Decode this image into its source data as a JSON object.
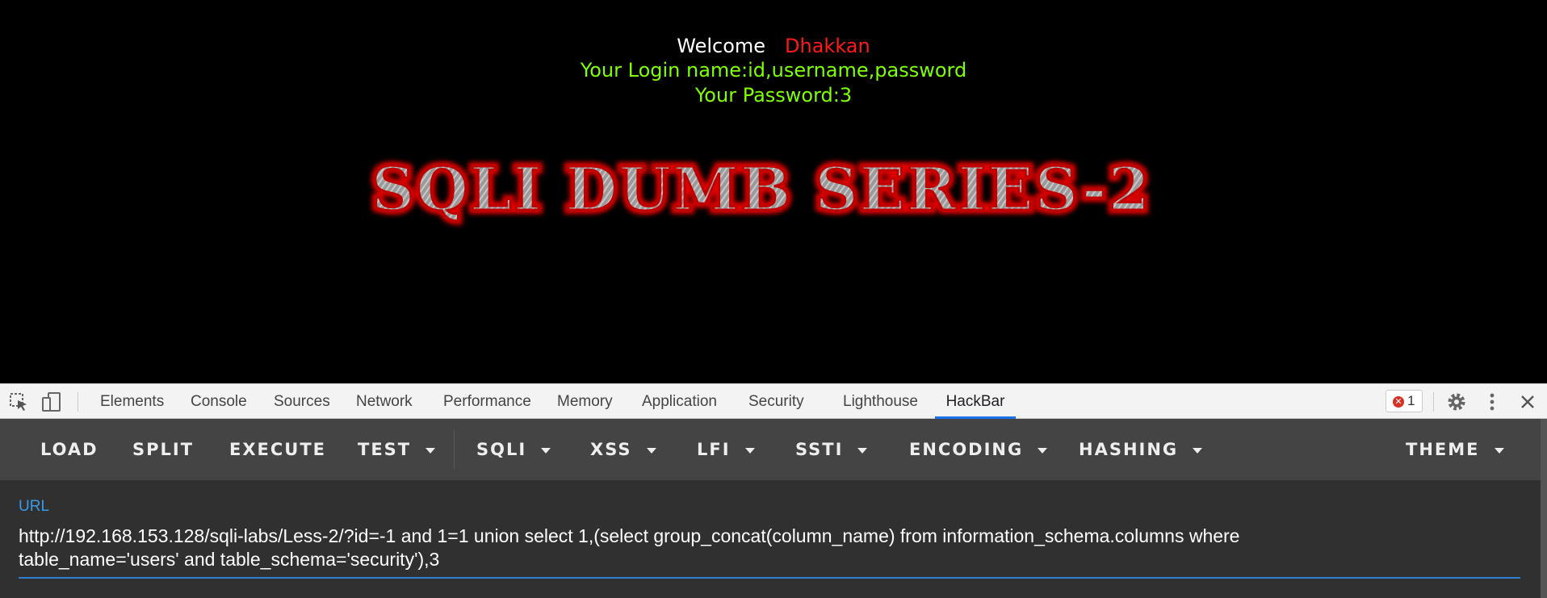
{
  "page": {
    "welcome_label": "Welcome",
    "user_name": "Dhakkan",
    "login_name_line": "Your Login name:id,username,password",
    "password_line": "Your Password:3",
    "banner_text": "SQLI DUMB SERIES-2"
  },
  "devtools": {
    "tabs": [
      "Elements",
      "Console",
      "Sources",
      "Network",
      "Performance",
      "Memory",
      "Application",
      "Security",
      "Lighthouse",
      "HackBar"
    ],
    "active_tab": "HackBar",
    "error_count": "1"
  },
  "hackbar": {
    "buttons": [
      "LOAD",
      "SPLIT",
      "EXECUTE",
      "TEST",
      "SQLI",
      "XSS",
      "LFI",
      "SSTI",
      "ENCODING",
      "HASHING",
      "THEME"
    ],
    "url_label": "URL",
    "url_value": "http://192.168.153.128/sqli-labs/Less-2/?id=-1 and 1=1 union select 1,(select group_concat(column_name) from information_schema.columns where table_name='users' and table_schema='security'),3"
  },
  "colors": {
    "page_background": "#000000",
    "welcome_text": "#ffffff",
    "user_name_text": "#ff1a1a",
    "info_text": "#7fff00",
    "banner_glow": "#e00000",
    "devtools_active_tab": "#1a73e8",
    "hackbar_background": "#444444",
    "url_label": "#3b9ae8"
  }
}
